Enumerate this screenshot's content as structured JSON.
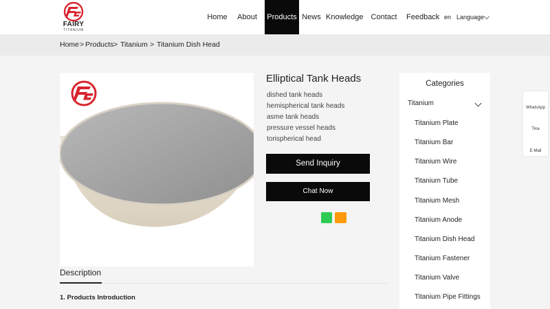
{
  "logo": {
    "word": "FAIRY",
    "sub": "TITANIUM",
    "brand_red": "#d9232e"
  },
  "nav": {
    "items": [
      "Home",
      "About Us",
      "Products",
      "News",
      "Knowledge",
      "Contact Us",
      "Feedback"
    ],
    "active": "Products",
    "lang_code": "en",
    "language_label": "Language"
  },
  "breadcrumb": {
    "home": "Home",
    "products": "Products",
    "titanium": "Titanium",
    "current": "Titanium Dish Head",
    "sep1": ">",
    "sep2": ">",
    "sep3": ">"
  },
  "product": {
    "title": "Elliptical Tank Heads",
    "keywords": [
      "dished tank heads",
      "hemispherical tank heads",
      "asme tank heads",
      "pressure vessel heads",
      "torispherical head"
    ],
    "send_inquiry": "Send Inquiry",
    "chat_now": "Chat Now",
    "share_colors": [
      "#2ecc55",
      "#ff9b0a"
    ]
  },
  "description": {
    "tab": "Description",
    "heading": "1. Products Introduction"
  },
  "categories": {
    "title": "Categories",
    "parent": "Titanium",
    "items": [
      "Titanium Plate",
      "Titanium Bar",
      "Titanium Wire",
      "Titanium Tube",
      "Titanium Mesh",
      "Titanium Anode",
      "Titanium Dish Head",
      "Titanium Fastener",
      "Titanium Valve",
      "Titanium Pipe Fittings"
    ]
  },
  "side_widget": {
    "whatsapp": "WhatsApp",
    "tina": "Tina",
    "email": "E-Mail"
  },
  "colors": {
    "nav_active_bg": "#0a0a0a",
    "button_bg": "#0a0a0a",
    "page_bg": "#f4f4f4",
    "breadcrumb_bg": "#ebebeb"
  }
}
